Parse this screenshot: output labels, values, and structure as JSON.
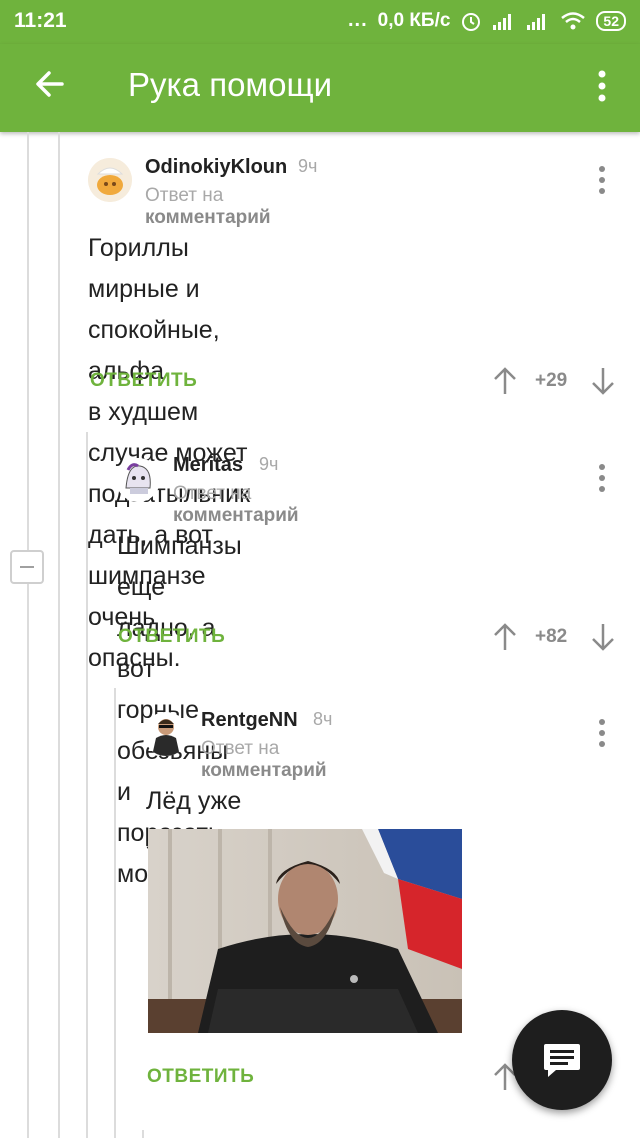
{
  "status_bar": {
    "time": "11:21",
    "dots": "...",
    "speed": "0,0 КБ/с",
    "battery": "52"
  },
  "app_bar": {
    "title": "Рука помощи"
  },
  "reply_word": "Ответ на",
  "reply_target": "комментарий",
  "comments": [
    {
      "author": "OdinokiyKloun",
      "time": "9ч",
      "text_lines": [
        "Гориллы мирные и спокойные, альфа",
        "в худшем случае может подзатыльник",
        "дать, а вот шимпанзе очень опасны."
      ],
      "reply_label": "ОТВЕТИТЬ",
      "rating": "+29"
    },
    {
      "author": "Meritas",
      "time": "9ч",
      "text_lines": [
        "Шимпанзы еще ладно, а вот горные",
        "обезьяны и порезать могут."
      ],
      "reply_label": "ОТВЕТИТЬ",
      "rating": "+82"
    },
    {
      "author": "RentgeNN",
      "time": "8ч",
      "text_lines": [
        "Лёд уже захрустел."
      ],
      "reply_label": "ОТВЕТИТЬ",
      "rating": ""
    }
  ],
  "colors": {
    "brand_green": "#6fb33d",
    "fab": "#1e1e1e"
  },
  "icons": [
    "back-arrow-icon",
    "overflow-menu-icon",
    "upvote-arrow-icon",
    "downvote-arrow-icon",
    "collapse-icon",
    "chat-icon"
  ]
}
